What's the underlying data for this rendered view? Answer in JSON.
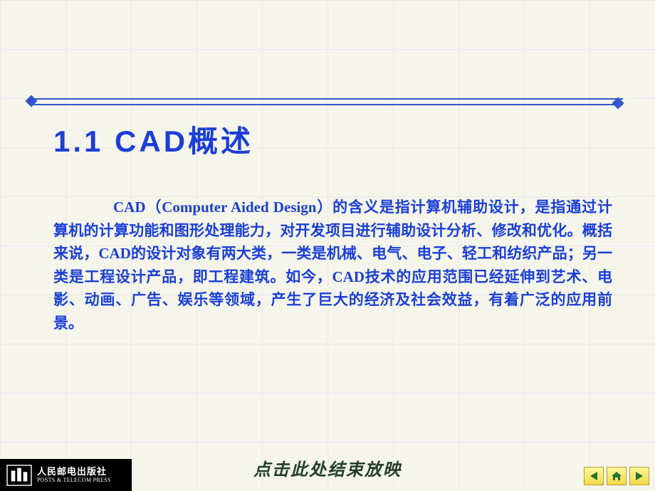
{
  "slide": {
    "section_number": "1.1",
    "section_title": "CAD概述",
    "full_title": "1.1   CAD概述",
    "body": "CAD（Computer Aided Design）的含义是指计算机辅助设计，是指通过计算机的计算功能和图形处理能力，对开发项目进行辅助设计分析、修改和优化。概括来说，CAD的设计对象有两大类，一类是机械、电气、电子、轻工和纺织产品；另一类是工程设计产品，即工程建筑。如今，CAD技术的应用范围已经延伸到艺术、电影、动画、广告、娱乐等领域，产生了巨大的经济及社会效益，有着广泛的应用前景。"
  },
  "publisher": {
    "name_cn": "人民邮电出版社",
    "name_en": "POSTS & TELECOM PRESS"
  },
  "footer": {
    "end_show_text": "点击此处结束放映"
  },
  "nav": {
    "prev_label": "previous",
    "home_label": "home",
    "next_label": "next"
  }
}
